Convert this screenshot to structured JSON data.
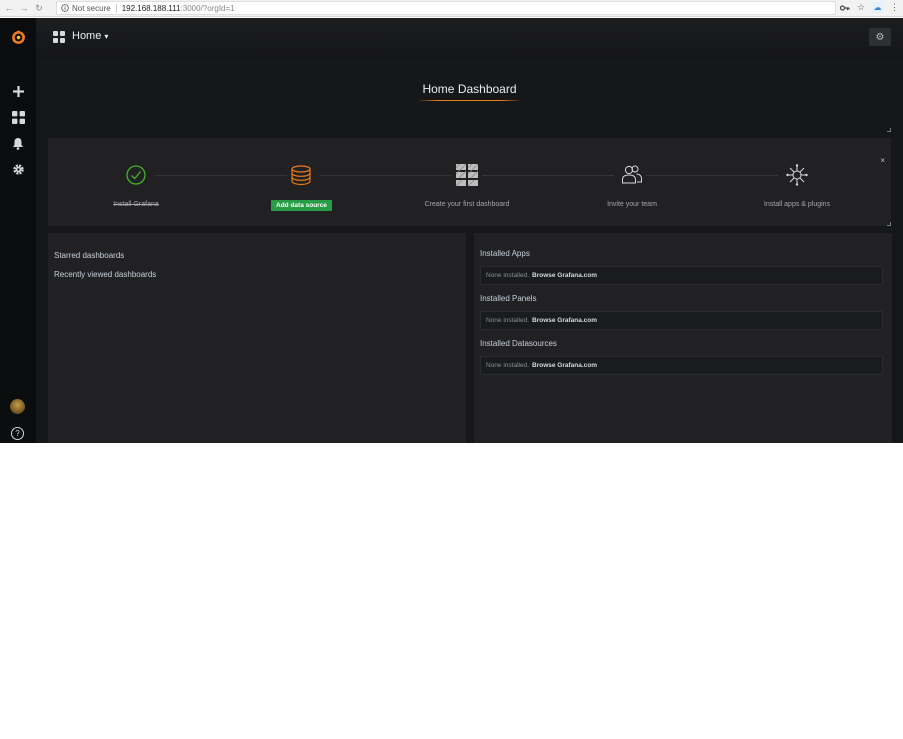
{
  "browser": {
    "security_label": "Not secure",
    "url_host": "192.168.188.111",
    "url_path": ":3000/?orgId=1"
  },
  "navbar": {
    "dashboard_title": "Home"
  },
  "title_panel": {
    "title": "Home Dashboard"
  },
  "getting_started": {
    "steps": [
      {
        "label": "Install Grafana",
        "state": "done",
        "icon": "check-circle-icon",
        "color": "#43b02a"
      },
      {
        "label": "Add data source",
        "state": "active",
        "icon": "database-icon",
        "color": "#eb7b18"
      },
      {
        "label": "Create your first dashboard",
        "state": "todo",
        "icon": "dashboard-grid-icon",
        "color": "#d8d9da"
      },
      {
        "label": "Invite your team",
        "state": "todo",
        "icon": "users-icon",
        "color": "#d8d9da"
      },
      {
        "label": "Install apps & plugins",
        "state": "todo",
        "icon": "plugin-icon",
        "color": "#d8d9da"
      }
    ],
    "close_label": "×"
  },
  "dashboards_panel": {
    "starred_label": "Starred dashboards",
    "recent_label": "Recently viewed dashboards"
  },
  "plugins_panel": {
    "sections": [
      {
        "title": "Installed Apps",
        "empty_text": "None installed.",
        "link_text": "Browse Grafana.com"
      },
      {
        "title": "Installed Panels",
        "empty_text": "None installed.",
        "link_text": "Browse Grafana.com"
      },
      {
        "title": "Installed Datasources",
        "empty_text": "None installed.",
        "link_text": "Browse Grafana.com"
      }
    ]
  },
  "colors": {
    "accent": "#eb7b18",
    "success": "#299c46",
    "background": "#161719",
    "panel": "#212124"
  }
}
